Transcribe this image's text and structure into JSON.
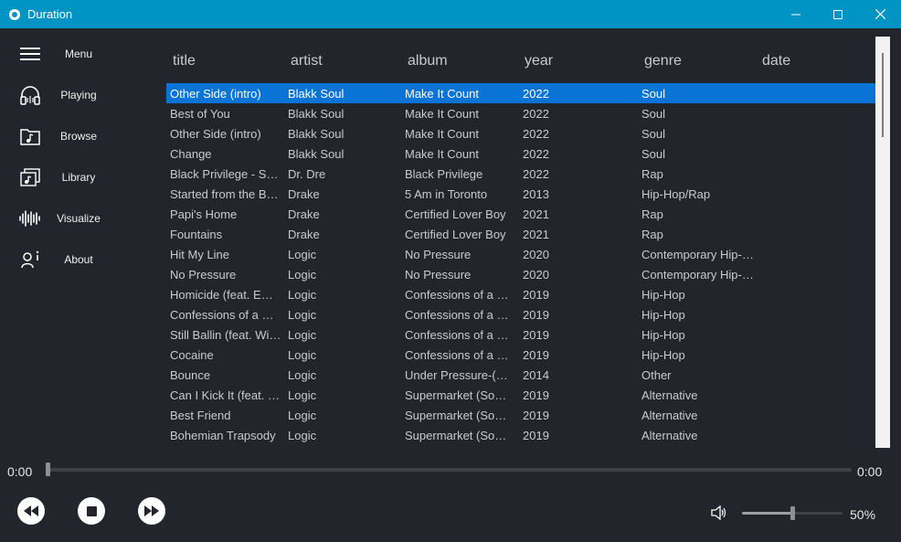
{
  "window": {
    "title": "Duration",
    "controls": [
      "minimize",
      "maximize",
      "close"
    ]
  },
  "sidebar": {
    "items": [
      {
        "label": "Menu",
        "icon": "hamburger-icon"
      },
      {
        "label": "Playing",
        "icon": "headphones-icon"
      },
      {
        "label": "Browse",
        "icon": "music-folder-icon"
      },
      {
        "label": "Library",
        "icon": "music-library-icon"
      },
      {
        "label": "Visualize",
        "icon": "waveform-icon"
      },
      {
        "label": "About",
        "icon": "person-info-icon"
      }
    ]
  },
  "table": {
    "columns": [
      "title",
      "artist",
      "album",
      "year",
      "genre",
      "date"
    ],
    "selected_row": 0,
    "rows": [
      [
        "Other Side (intro)",
        "Blakk Soul",
        "Make It Count",
        "2022",
        "Soul",
        ""
      ],
      [
        "Best of You",
        "Blakk Soul",
        "Make It Count",
        "2022",
        "Soul",
        ""
      ],
      [
        "Other Side (intro)",
        "Blakk Soul",
        "Make It Count",
        "2022",
        "Soul",
        ""
      ],
      [
        "Change",
        "Blakk Soul",
        "Make It Count",
        "2022",
        "Soul",
        ""
      ],
      [
        "Black Privilege - Son...",
        "Dr. Dre",
        "Black Privilege",
        "2022",
        "Rap",
        ""
      ],
      [
        "Started from the Bott...",
        "Drake",
        "5 Am in Toronto",
        "2013",
        "Hip-Hop/Rap",
        ""
      ],
      [
        "Papi's Home",
        "Drake",
        "Certified Lover Boy",
        "2021",
        "Rap",
        ""
      ],
      [
        "Fountains",
        "Drake",
        "Certified Lover Boy",
        "2021",
        "Rap",
        ""
      ],
      [
        "Hit My Line",
        "Logic",
        "No Pressure",
        "2020",
        "Contemporary Hip-H...",
        ""
      ],
      [
        "No Pressure",
        "Logic",
        "No Pressure",
        "2020",
        "Contemporary Hip-H...",
        ""
      ],
      [
        "Homicide (feat. Emi...",
        "Logic",
        "Confessions of a Da...",
        "2019",
        "Hip-Hop",
        ""
      ],
      [
        "Confessions of a Da...",
        "Logic",
        "Confessions of a Da...",
        "2019",
        "Hip-Hop",
        ""
      ],
      [
        "Still Ballin (feat. Wiz ...",
        "Logic",
        "Confessions of a Da...",
        "2019",
        "Hip-Hop",
        ""
      ],
      [
        "Cocaine",
        "Logic",
        "Confessions of a Da...",
        "2019",
        "Hip-Hop",
        ""
      ],
      [
        "Bounce",
        "Logic",
        "Under Pressure-(Del...",
        "2014",
        "Other",
        ""
      ],
      [
        "Can I Kick It (feat. Jut...",
        "Logic",
        "Supermarket (Soun...",
        "2019",
        "Alternative",
        ""
      ],
      [
        "Best Friend",
        "Logic",
        "Supermarket (Soun...",
        "2019",
        "Alternative",
        ""
      ],
      [
        "Bohemian Trapsody",
        "Logic",
        "Supermarket (Soun...",
        "2019",
        "Alternative",
        ""
      ]
    ]
  },
  "player": {
    "elapsed": "0:00",
    "total": "0:00",
    "seek_fraction": 0,
    "volume_text": "50%",
    "volume_fraction": 0.5,
    "buttons": [
      "rewind",
      "stop",
      "fast-forward"
    ]
  },
  "colors": {
    "accent": "#0094c4",
    "selection": "#0a74d6",
    "background": "#22252b"
  }
}
